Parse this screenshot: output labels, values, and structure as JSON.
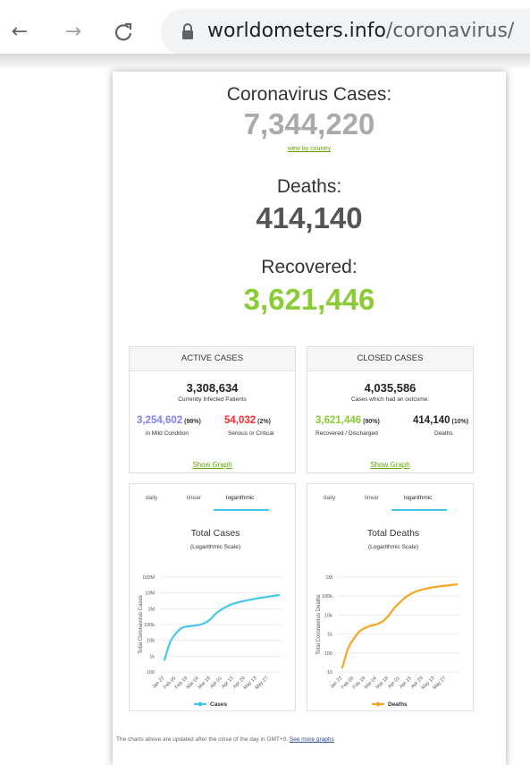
{
  "browser": {
    "url_domain": "worldometers.info",
    "url_path": "/coronavirus/",
    "back_glyph": "←",
    "forward_glyph": "→",
    "reload_glyph": "C"
  },
  "summary": {
    "cases_label": "Coronavirus Cases:",
    "cases_value": "7,344,220",
    "view_by_country": "view by country",
    "deaths_label": "Deaths:",
    "deaths_value": "414,140",
    "recovered_label": "Recovered:",
    "recovered_value": "3,621,446",
    "cases_color": "#aaaaaa",
    "deaths_color": "#555555",
    "recovered_color": "#8acc34"
  },
  "active_cases": {
    "title": "ACTIVE CASES",
    "total": "3,308,634",
    "total_label": "Currently Infected Patients",
    "mild_value": "3,254,602",
    "mild_pct": "(98%)",
    "mild_label": "in Mild Condition",
    "serious_value": "54,032",
    "serious_pct": "(2%)",
    "serious_label": "Serious or Critical",
    "show_graph": "Show Graph"
  },
  "closed_cases": {
    "title": "CLOSED CASES",
    "total": "4,035,586",
    "total_label": "Cases which had an outcome:",
    "recovered_value": "3,621,446",
    "recovered_pct": "(90%)",
    "recovered_label": "Recovered / Discharged",
    "deaths_value": "414,140",
    "deaths_pct": "(10%)",
    "deaths_label": "Deaths",
    "show_graph": "Show Graph"
  },
  "graph_tabs": [
    "daily",
    "linear",
    "logarithmic"
  ],
  "footer": {
    "text": "The charts above are updated after the close of the day in GMT+0.",
    "link": "See more graphs"
  },
  "chart_data": [
    {
      "type": "line",
      "title": "Total Cases",
      "subtitle": "(Logarithmic Scale)",
      "ylabel": "Total Coronavirus Cases",
      "yscale": "log",
      "ylim": [
        100,
        100000000
      ],
      "y_ticks": [
        "100M",
        "10M",
        "1M",
        "100k",
        "10k",
        "1k",
        "100"
      ],
      "x_ticks": [
        "Jan 22",
        "Feb 05",
        "Feb 19",
        "Mar 04",
        "Mar 18",
        "Apr 01",
        "Apr 15",
        "Apr 29",
        "May 13",
        "May 27"
      ],
      "legend": "bottom",
      "color": "#44c7ea",
      "series": [
        {
          "name": "Cases",
          "x": [
            "Jan 22",
            "Jan 29",
            "Feb 05",
            "Feb 12",
            "Feb 19",
            "Feb 26",
            "Mar 04",
            "Mar 11",
            "Mar 18",
            "Mar 25",
            "Apr 01",
            "Apr 08",
            "Apr 15",
            "Apr 22",
            "Apr 29",
            "May 06",
            "May 13",
            "May 20",
            "May 27",
            "Jun 03",
            "Jun 09"
          ],
          "values": [
            580,
            7800,
            28000,
            60000,
            76000,
            83000,
            95000,
            126000,
            220000,
            530000,
            940000,
            1510000,
            2080000,
            2620000,
            3210000,
            3760000,
            4420000,
            5070000,
            5780000,
            6580000,
            7344220
          ]
        }
      ]
    },
    {
      "type": "line",
      "title": "Total Deaths",
      "subtitle": "(Logarithmic Scale)",
      "ylabel": "Total Coronavirus Deaths",
      "yscale": "log",
      "ylim": [
        10,
        1000000
      ],
      "y_ticks": [
        "1M",
        "100k",
        "10k",
        "1k",
        "100",
        "10"
      ],
      "x_ticks": [
        "Jan 22",
        "Feb 05",
        "Feb 19",
        "Mar 04",
        "Mar 18",
        "Apr 01",
        "Apr 15",
        "Apr 29",
        "May 13",
        "May 27"
      ],
      "legend": "bottom",
      "color": "#f7a622",
      "series": [
        {
          "name": "Deaths",
          "x": [
            "Jan 22",
            "Jan 29",
            "Feb 05",
            "Feb 12",
            "Feb 19",
            "Feb 26",
            "Mar 04",
            "Mar 11",
            "Mar 18",
            "Mar 25",
            "Apr 01",
            "Apr 08",
            "Apr 15",
            "Apr 22",
            "Apr 29",
            "May 06",
            "May 13",
            "May 20",
            "May 27",
            "Jun 03",
            "Jun 09"
          ],
          "values": [
            17,
            170,
            560,
            1370,
            2130,
            2770,
            3290,
            4630,
            9000,
            23000,
            47000,
            88000,
            135000,
            184000,
            227000,
            263000,
            298000,
            328000,
            355000,
            385000,
            414140
          ]
        }
      ]
    }
  ]
}
